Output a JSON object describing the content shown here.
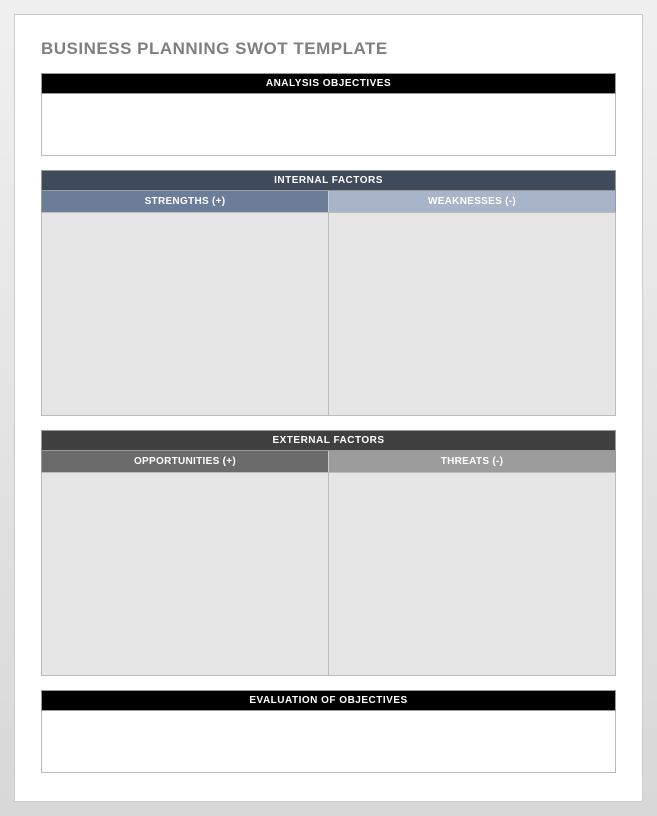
{
  "title": "BUSINESS PLANNING SWOT TEMPLATE",
  "sections": {
    "objectives": {
      "header": "ANALYSIS OBJECTIVES"
    },
    "internal": {
      "header": "INTERNAL FACTORS",
      "left": "STRENGTHS (+)",
      "right": "WEAKNESSES (-)"
    },
    "external": {
      "header": "EXTERNAL FACTORS",
      "left": "OPPORTUNITIES (+)",
      "right": "THREATS (-)"
    },
    "evaluation": {
      "header": "EVALUATION OF OBJECTIVES"
    }
  }
}
